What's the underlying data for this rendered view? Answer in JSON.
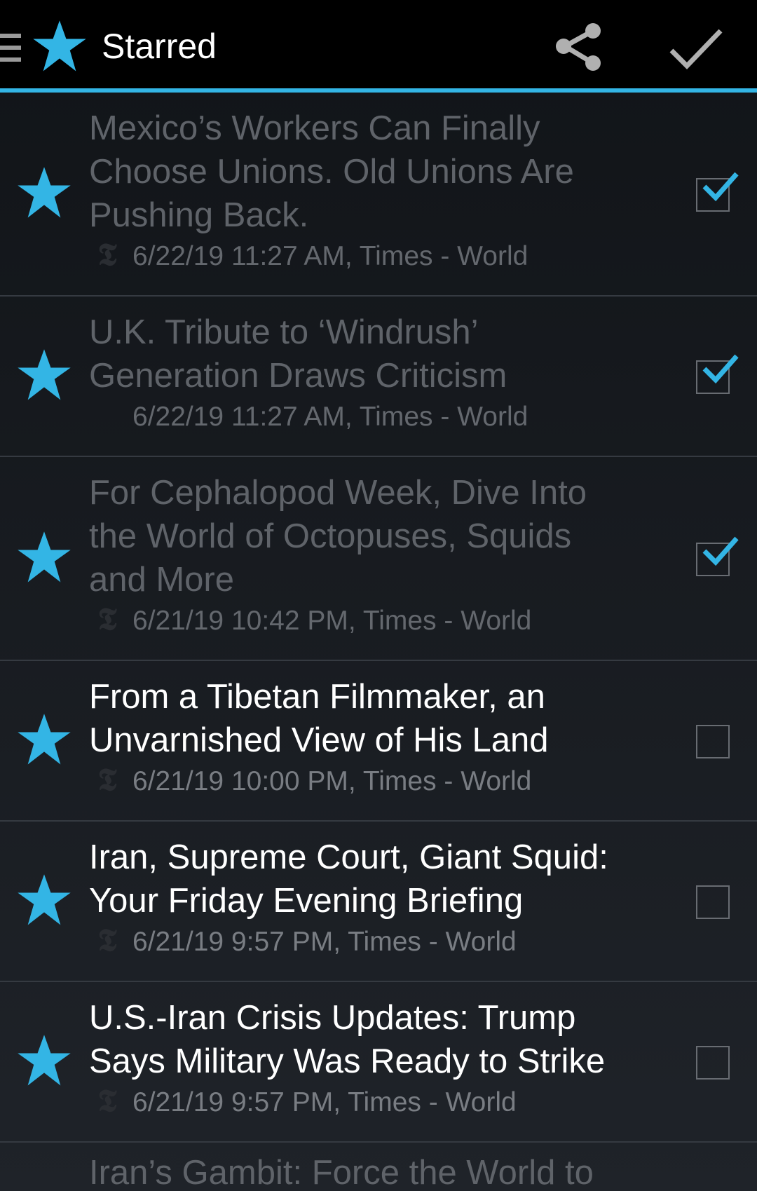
{
  "header": {
    "title": "Starred",
    "icons": {
      "drawer": "menu-icon",
      "app": "star-icon",
      "share": "share-icon",
      "done": "check-icon"
    }
  },
  "colors": {
    "accent": "#33b5e5",
    "read_text": "#5f6369",
    "unread_text": "#ffffff"
  },
  "articles": [
    {
      "lines": [
        "Mexico’s Workers Can Finally",
        "Choose Unions. Old Unions Are",
        "Pushing Back."
      ],
      "meta": "6/22/19 11:27 AM, Times - World",
      "logo": "𝕿",
      "checked": true,
      "read": true
    },
    {
      "lines": [
        "U.K. Tribute to ‘Windrush’",
        "Generation Draws Criticism"
      ],
      "meta": "6/22/19 11:27 AM, Times - World",
      "logo": "",
      "checked": true,
      "read": true
    },
    {
      "lines": [
        "For Cephalopod Week, Dive Into",
        "the World of Octopuses, Squids",
        "and More"
      ],
      "meta": "6/21/19 10:42 PM, Times - World",
      "logo": "𝕿",
      "checked": true,
      "read": true
    },
    {
      "lines": [
        "From a Tibetan Filmmaker, an",
        "Unvarnished View of His Land"
      ],
      "meta": "6/21/19 10:00 PM, Times - World",
      "logo": "𝕿",
      "checked": false,
      "read": false
    },
    {
      "lines": [
        "Iran, Supreme Court, Giant Squid:",
        "Your Friday Evening Briefing"
      ],
      "meta": "6/21/19 9:57 PM, Times - World",
      "logo": "𝕿",
      "checked": false,
      "read": false
    },
    {
      "lines": [
        "U.S.-Iran Crisis Updates: Trump",
        "Says Military Was Ready to Strike"
      ],
      "meta": "6/21/19 9:57 PM, Times - World",
      "logo": "𝕿",
      "checked": false,
      "read": false
    }
  ],
  "partial": {
    "headline": "Iran’s Gambit: Force the World to"
  }
}
